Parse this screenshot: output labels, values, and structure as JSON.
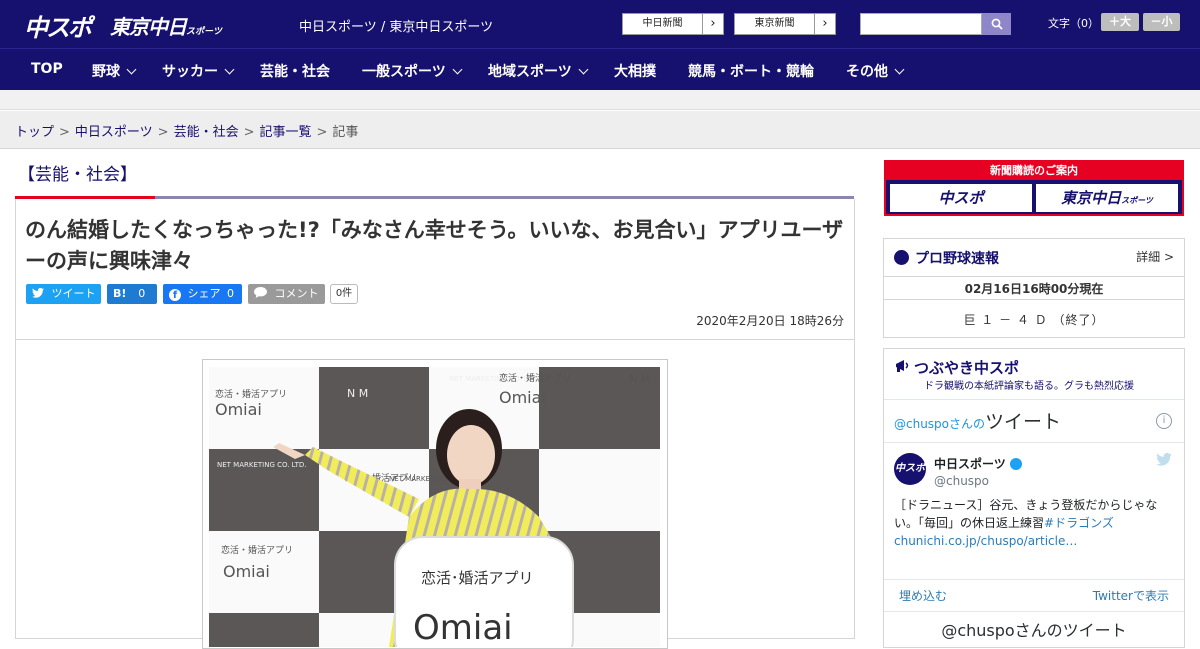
{
  "header": {
    "logo_primary": "中スポ",
    "logo_secondary": "東京中日",
    "logo_secondary_small": "スポーツ",
    "site_links": "中日スポーツ / 東京中日スポーツ",
    "paper_buttons": [
      "中日新聞",
      "東京新聞"
    ],
    "search_placeholder": "",
    "fontsize_label": "文字（0）",
    "fontsize_up": "＋大",
    "fontsize_down": "－小"
  },
  "nav": {
    "items": [
      {
        "label": "TOP",
        "caret": false
      },
      {
        "label": "野球",
        "caret": true
      },
      {
        "label": "サッカー",
        "caret": true
      },
      {
        "label": "芸能・社会",
        "caret": false
      },
      {
        "label": "一般スポーツ",
        "caret": true
      },
      {
        "label": "地域スポーツ",
        "caret": true
      },
      {
        "label": "大相撲",
        "caret": false
      },
      {
        "label": "競馬・ボート・競輪",
        "caret": false
      },
      {
        "label": "その他",
        "caret": true
      }
    ]
  },
  "breadcrumb": {
    "items": [
      "トップ",
      "中日スポーツ",
      "芸能・社会",
      "記事一覧"
    ],
    "current": "記事",
    "separator": ">"
  },
  "article": {
    "category": "【芸能・社会】",
    "headline": "のん結婚したくなっちゃった!?「みなさん幸せそう。いいな、お見合い」アプリユーザーの声に興味津々",
    "share": {
      "tweet": "ツイート",
      "hatena": "B!",
      "hatena_count": "0",
      "facebook": "シェア",
      "facebook_count": "0",
      "comment": "コメント",
      "comment_count": "0件"
    },
    "date": "2020年2月20日 18時26分",
    "photo_texts": {
      "backdrop_small": "恋活・婚活アプリ",
      "backdrop_brand": "Omiai",
      "backdrop_company": "NET MARKETING CO. LTD.",
      "backdrop_monogram": "N M",
      "board_line1": "恋活･婚活アプリ",
      "board_line2": "Omiai"
    }
  },
  "sidebar": {
    "ad": {
      "banner": "新聞購読のご案内",
      "left": "中スポ",
      "right": "東京中日",
      "right_small": "スポーツ"
    },
    "probaseball": {
      "title": "プロ野球速報",
      "detail": "詳細 >",
      "as_of": "02月16日16時00分現在",
      "score": "巨 １ － ４ Ｄ （終了）"
    },
    "tweets": {
      "title": "つぶやき中スポ",
      "subtitle": "ドラ観戦の本紙評論家も語る。グラも熱烈応援",
      "embed_prefix": "@chuspoさんの",
      "embed_title": "ツイート",
      "info": "i",
      "avatar": "中スポ",
      "name": "中日スポーツ",
      "handle": "@chuspo",
      "text_main": "［ドラニュース］谷元、きょう登板だからじゃない。「毎回」の休日返上練習",
      "text_hashtag": "#ドラゴンズ",
      "text_link": "chunichi.co.jp/chuspo/article…",
      "embed_link": "埋め込む",
      "view_link": "Twitterで表示",
      "footer": "@chuspoさんのツイート"
    }
  },
  "colors": {
    "brand_navy": "#16106e",
    "accent_red": "#e60022",
    "link_blue": "#2b7bb9",
    "twitter_blue": "#1da1f2",
    "facebook_blue": "#1877f2"
  }
}
